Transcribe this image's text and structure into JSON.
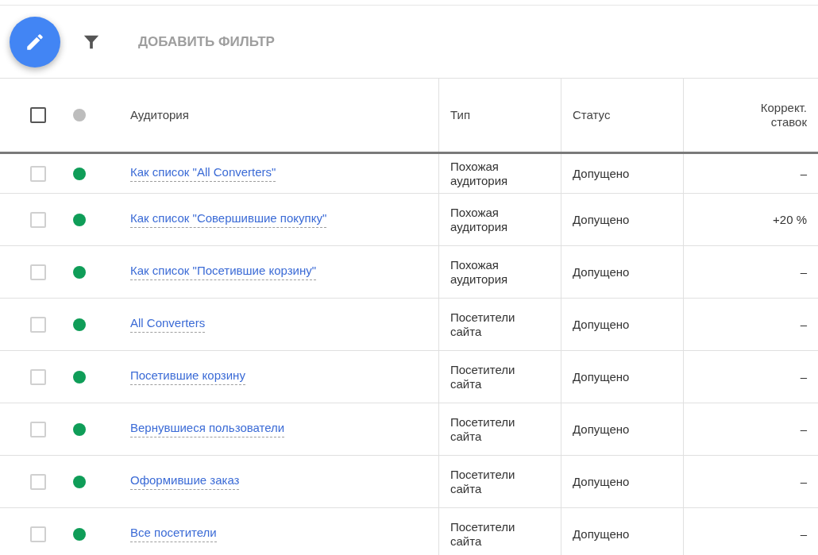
{
  "toolbar": {
    "add_filter": "ДОБАВИТЬ ФИЛЬТР"
  },
  "table": {
    "header": {
      "checked": false,
      "color": "#bdbdbd",
      "columns": [
        "Аудитория",
        "Тип",
        "Статус",
        "Коррект. ставок"
      ]
    },
    "rows": [
      {
        "checked": false,
        "color": "#0f9d58",
        "audience": "Как список \"All Converters\"",
        "type": "Похожая аудитория",
        "status": "Допущено",
        "bid": "–"
      },
      {
        "checked": false,
        "color": "#0f9d58",
        "audience": "Как список \"Совершившие покупку\"",
        "type": "Похожая аудитория",
        "status": "Допущено",
        "bid": "+20 %"
      },
      {
        "checked": false,
        "color": "#0f9d58",
        "audience": "Как список \"Посетившие корзину\"",
        "type": "Похожая аудитория",
        "status": "Допущено",
        "bid": "–"
      },
      {
        "checked": false,
        "color": "#0f9d58",
        "audience": "All Converters",
        "type": "Посетители сайта",
        "status": "Допущено",
        "bid": "–"
      },
      {
        "checked": false,
        "color": "#0f9d58",
        "audience": "Посетившие корзину",
        "type": "Посетители сайта",
        "status": "Допущено",
        "bid": "–"
      },
      {
        "checked": false,
        "color": "#0f9d58",
        "audience": "Вернувшиеся пользователи",
        "type": "Посетители сайта",
        "status": "Допущено",
        "bid": "–"
      },
      {
        "checked": false,
        "color": "#0f9d58",
        "audience": "Оформившие заказ",
        "type": "Посетители сайта",
        "status": "Допущено",
        "bid": "–"
      },
      {
        "checked": false,
        "color": "#0f9d58",
        "audience": "Все посетители",
        "type": "Посетители сайта",
        "status": "Допущено",
        "bid": "–"
      }
    ]
  }
}
